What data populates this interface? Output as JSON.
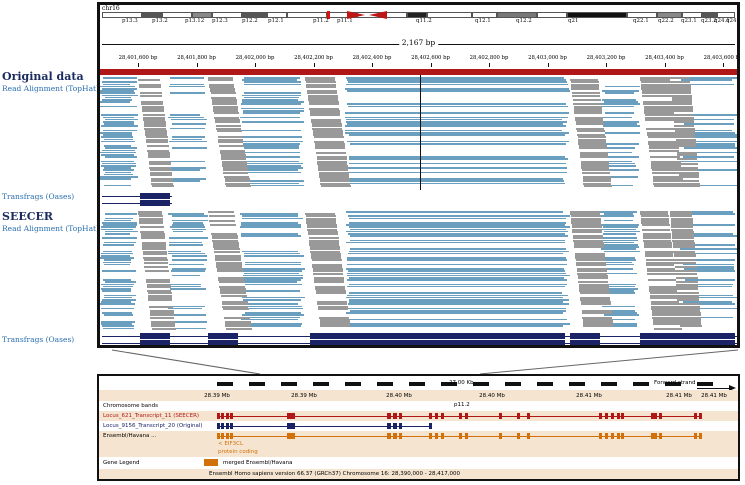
{
  "labels": {
    "original_title": "Original data",
    "original_reads": "Read Alignment (TopHat)",
    "original_transfrags": "Transfrags (Oases)",
    "seecer_title": "SEECER",
    "seecer_reads": "Read Alignment (TopHat)",
    "seecer_transfrags": "Transfrags (Oases)"
  },
  "igv": {
    "chromosome": "chr16",
    "span": "2,167 bp",
    "bands": [
      "p13.3",
      "p13.2",
      "p13.12",
      "p12.3",
      "p12.2",
      "p12.1",
      "p11.2",
      "p11.1",
      "q11.2",
      "q12.1",
      "q12.2",
      "q21",
      "q22.1",
      "q22.2",
      "q23.1",
      "q23.2",
      "q24.1",
      "q24"
    ],
    "ticks": [
      "28,401,600 bp",
      "28,401,800 bp",
      "28,402,000 bp",
      "28,402,200 bp",
      "28,402,400 bp",
      "28,402,600 bp",
      "28,402,800 bp",
      "28,403,000 bp",
      "28,403,200 bp",
      "28,403,400 bp",
      "28,403,600 bp"
    ]
  },
  "ensembl": {
    "kb": "27.00 Kb",
    "strand": "Forward strand",
    "scale": [
      "28.39 Mb",
      "28.39 Mb",
      "28.40 Mb",
      "28.40 Mb",
      "28.41 Mb",
      "28.41 Mb",
      "28.41 Mb"
    ],
    "band_label": "p11.2",
    "rows": {
      "chrom_bands": "Chromosome bands",
      "seecer": "Locus_621_Transcript_11 (SEECER)",
      "original": "Locus_9156_Transcript_20 (Original)",
      "ensembl": "Ensembl/Havana ...",
      "gene_legend": "Gene Legend"
    },
    "gene_name": "< EIF3CL",
    "protein_coding": "protein coding",
    "legend_item": "merged Ensembl/Havana",
    "footer": "Ensembl Homo sapiens version 66.37 (GRCh37) Chromosome 16: 28,390,000 - 28,417,000"
  },
  "colors": {
    "seecer": "#b01818",
    "original": "#1a2366",
    "ensembl": "#d2700a",
    "read": "#6a9fc0",
    "spliced": "#999999"
  }
}
